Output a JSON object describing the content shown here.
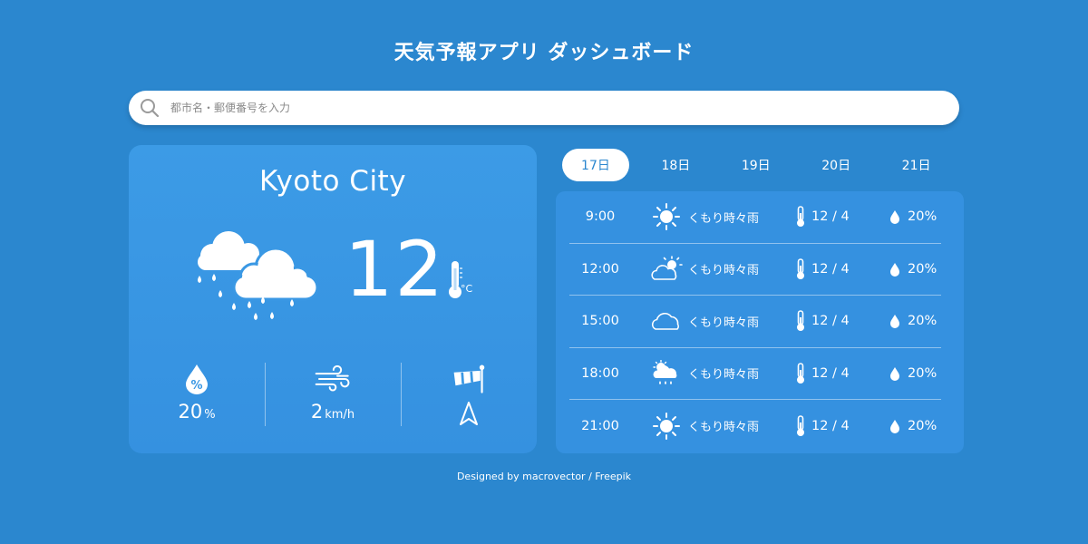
{
  "app": {
    "title": "天気予報アプリ ダッシュボード"
  },
  "search": {
    "placeholder": "都市名・郵便番号を入力",
    "value": "",
    "icon": "search-icon"
  },
  "current": {
    "city": "Kyoto City",
    "temperature": "12",
    "temperature_unit": "°C",
    "icon": "rain-cloud-icon",
    "humidity": {
      "value": "20",
      "unit": "%",
      "icon": "humidity-icon"
    },
    "wind": {
      "value": "2",
      "unit": "km/h",
      "icon": "wind-icon"
    },
    "direction": {
      "icon": "windsock-icon",
      "arrow": "navigation-arrow-icon"
    }
  },
  "tabs": [
    {
      "label": "17日",
      "active": true
    },
    {
      "label": "18日",
      "active": false
    },
    {
      "label": "19日",
      "active": false
    },
    {
      "label": "20日",
      "active": false
    },
    {
      "label": "21日",
      "active": false
    }
  ],
  "forecast": [
    {
      "time": "9:00",
      "icon": "sun-icon",
      "condition": "くもり時々雨",
      "temp": "12 / 4",
      "rain": "20%"
    },
    {
      "time": "12:00",
      "icon": "sun-cloud-icon",
      "condition": "くもり時々雨",
      "temp": "12 / 4",
      "rain": "20%"
    },
    {
      "time": "15:00",
      "icon": "cloud-icon",
      "condition": "くもり時々雨",
      "temp": "12 / 4",
      "rain": "20%"
    },
    {
      "time": "18:00",
      "icon": "sun-rain-cloud-icon",
      "condition": "くもり時々雨",
      "temp": "12 / 4",
      "rain": "20%"
    },
    {
      "time": "21:00",
      "icon": "sun-icon",
      "condition": "くもり時々雨",
      "temp": "12 / 4",
      "rain": "20%"
    }
  ],
  "footer": {
    "credit": "Designed by macrovector / Freepik"
  },
  "colors": {
    "background": "#2b87cf",
    "card": "#3591e0",
    "accent": "#2b87cf",
    "text": "#ffffff"
  }
}
